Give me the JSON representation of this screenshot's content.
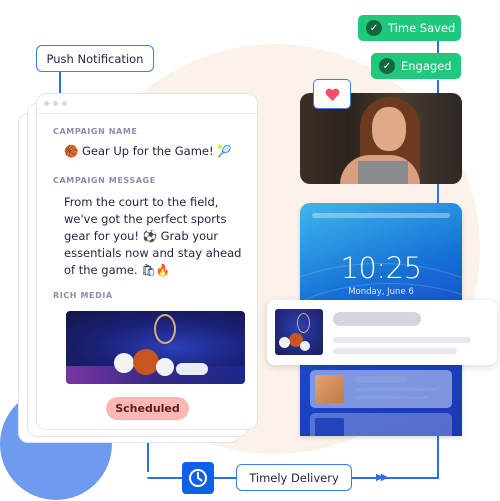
{
  "header": {
    "push_notification_label": "Push Notification"
  },
  "campaign_card": {
    "name_label": "CAMPAIGN NAME",
    "name_value": "🏀 Gear Up for the Game! 🎾",
    "message_label": "CAMPAIGN MESSAGE",
    "message_value": "From the court to the field, we've got the perfect sports gear for you! ⚽ Grab your essentials now and stay ahead of the game. 🛍🔥",
    "rich_media_label": "RICH MEDIA",
    "rich_media_image": "sports-gear-image",
    "status_badge": "Scheduled"
  },
  "outcomes": {
    "time_saved": "Time Saved",
    "engaged": "Engaged"
  },
  "phone": {
    "time": "10:25",
    "date": "Monday, June 6"
  },
  "flow": {
    "timely_delivery_label": "Timely Delivery"
  },
  "icons": {
    "heart": "heart-icon",
    "clock": "clock-icon",
    "check": "check-icon",
    "arrows": "double-arrow-icon"
  },
  "colors": {
    "accent_blue": "#2f6fe6",
    "success_green": "#1fc97b",
    "scheduled_pink": "#fbb7b5",
    "heart_red": "#f2506a"
  }
}
